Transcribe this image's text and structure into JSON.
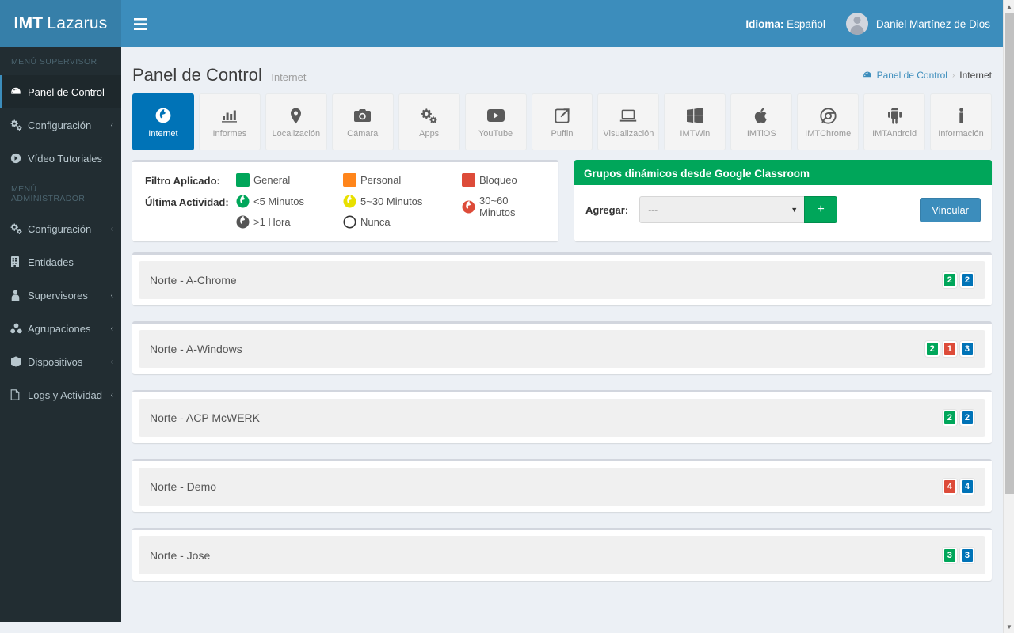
{
  "header": {
    "logo_bold": "IMT",
    "logo_light": "Lazarus",
    "menu_toggle_icon": "hamburger-icon",
    "language_label": "Idioma:",
    "language_value": "Español",
    "user_name": "Daniel Martínez de Dios"
  },
  "sidebar": {
    "supervisor_header": "MENÚ SUPERVISOR",
    "admin_header": "MENÚ ADMINISTRADOR",
    "supervisor_items": [
      {
        "label": "Panel de Control",
        "icon": "dashboard-icon",
        "active": true,
        "caret": ""
      },
      {
        "label": "Configuración",
        "icon": "gears-icon",
        "active": false,
        "caret": "‹"
      },
      {
        "label": "Vídeo Tutoriales",
        "icon": "play-circle-icon",
        "active": false,
        "caret": ""
      }
    ],
    "admin_items": [
      {
        "label": "Configuración",
        "icon": "gears-icon",
        "active": false,
        "caret": "‹"
      },
      {
        "label": "Entidades",
        "icon": "building-icon",
        "active": false,
        "caret": ""
      },
      {
        "label": "Supervisores",
        "icon": "user-tie-icon",
        "active": false,
        "caret": "‹"
      },
      {
        "label": "Agrupaciones",
        "icon": "sitemap-icon",
        "active": false,
        "caret": "‹"
      },
      {
        "label": "Dispositivos",
        "icon": "cube-icon",
        "active": false,
        "caret": "‹"
      },
      {
        "label": "Logs y Actividad",
        "icon": "file-icon",
        "active": false,
        "caret": "‹"
      }
    ]
  },
  "page": {
    "title": "Panel de Control",
    "subtitle": "Internet",
    "breadcrumb": {
      "icon": "dashboard-icon",
      "root": "Panel de Control",
      "separator": "›",
      "current": "Internet"
    }
  },
  "tabs": [
    {
      "label": "Internet",
      "icon": "globe-clock-icon",
      "active": true
    },
    {
      "label": "Informes",
      "icon": "bar-chart-icon",
      "active": false
    },
    {
      "label": "Localización",
      "icon": "map-marker-icon",
      "active": false
    },
    {
      "label": "Cámara",
      "icon": "camera-icon",
      "active": false
    },
    {
      "label": "Apps",
      "icon": "gears-icon",
      "active": false
    },
    {
      "label": "YouTube",
      "icon": "youtube-icon",
      "active": false
    },
    {
      "label": "Puffin",
      "icon": "share-icon",
      "active": false
    },
    {
      "label": "Visualización",
      "icon": "laptop-icon",
      "active": false
    },
    {
      "label": "IMTWin",
      "icon": "windows-icon",
      "active": false
    },
    {
      "label": "IMTiOS",
      "icon": "apple-icon",
      "active": false
    },
    {
      "label": "IMTChrome",
      "icon": "chrome-icon",
      "active": false
    },
    {
      "label": "IMTAndroid",
      "icon": "android-icon",
      "active": false
    },
    {
      "label": "Información",
      "icon": "info-icon",
      "active": false
    }
  ],
  "legend": {
    "filter_title": "Filtro Aplicado:",
    "activity_title": "Última Actividad:",
    "filters": [
      {
        "label": "General",
        "color": "#00a65a"
      },
      {
        "label": "Personal",
        "color": "#ff851b"
      },
      {
        "label": "Bloqueo",
        "color": "#dd4b39"
      }
    ],
    "activity_row1": [
      {
        "label": "<5 Minutos",
        "color": "#00a65a",
        "icon": "globe-icon"
      },
      {
        "label": "5~30 Minutos",
        "color": "#e8e000",
        "icon": "globe-icon"
      },
      {
        "label": "30~60 Minutos",
        "color": "#dd4b39",
        "icon": "globe-icon"
      }
    ],
    "activity_row2": [
      {
        "label": ">1 Hora",
        "color": "#555555",
        "icon": "globe-icon"
      },
      {
        "label": "Nunca",
        "color": "#ffffff",
        "icon": "circle-outline-icon"
      }
    ]
  },
  "classroom": {
    "title": "Grupos dinámicos desde Google Classroom",
    "add_label": "Agregar:",
    "select_value": "---",
    "select_caret": "▼",
    "add_button_icon": "plus-icon",
    "add_button_label": "+",
    "link_button_label": "Vincular"
  },
  "groups": [
    {
      "name": "Norte - A-Chrome",
      "badges": [
        {
          "value": "2",
          "color": "#00a65a"
        },
        {
          "value": "2",
          "color": "#0073b7"
        }
      ]
    },
    {
      "name": "Norte - A-Windows",
      "badges": [
        {
          "value": "2",
          "color": "#00a65a"
        },
        {
          "value": "1",
          "color": "#dd4b39"
        },
        {
          "value": "3",
          "color": "#0073b7"
        }
      ]
    },
    {
      "name": "Norte - ACP McWERK",
      "badges": [
        {
          "value": "2",
          "color": "#00a65a"
        },
        {
          "value": "2",
          "color": "#0073b7"
        }
      ]
    },
    {
      "name": "Norte - Demo",
      "badges": [
        {
          "value": "4",
          "color": "#dd4b39"
        },
        {
          "value": "4",
          "color": "#0073b7"
        }
      ]
    },
    {
      "name": "Norte - Jose",
      "badges": [
        {
          "value": "3",
          "color": "#00a65a"
        },
        {
          "value": "3",
          "color": "#0073b7"
        }
      ]
    }
  ],
  "scrollbars": {
    "vertical_up_arrow": "▲",
    "vertical_down_arrow": "▼"
  }
}
